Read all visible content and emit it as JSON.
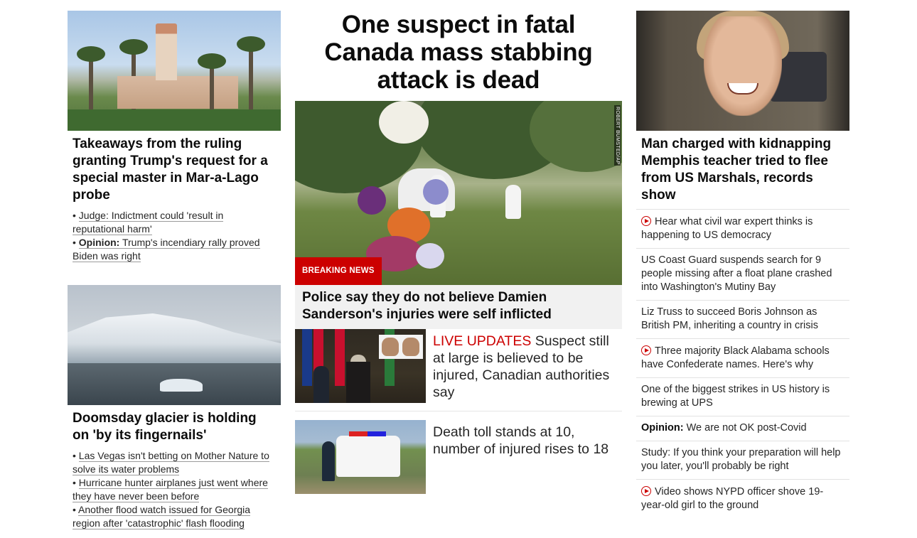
{
  "left": {
    "story1": {
      "image": "mar-a-lago-estate-photo",
      "headline": "Takeaways from the ruling granting Trump's request for a special master in Mar-a-Lago probe",
      "bullets": [
        {
          "label": "",
          "text": "Judge: Indictment could 'result in reputational harm'"
        },
        {
          "label": "Opinion:",
          "text": "Trump's incendiary rally proved Biden was right"
        }
      ]
    },
    "story2": {
      "image": "thwaites-glacier-photo",
      "headline": "Doomsday glacier is holding on 'by its fingernails'",
      "bullets": [
        {
          "label": "",
          "text": "Las Vegas isn't betting on Mother Nature to solve its water problems"
        },
        {
          "label": "",
          "text": "Hurricane hunter airplanes just went where they have never been before"
        },
        {
          "label": "",
          "text": "Another flood watch issued for Georgia region after 'catastrophic' flash flooding"
        }
      ]
    }
  },
  "center": {
    "hero_title": "One suspect in fatal Canada mass stabbing attack is dead",
    "hero_image_credit": "ROBERT BUMSTED/AP",
    "breaking_label": "BREAKING NEWS",
    "hero_sub": "Police say they do not believe Damien Sanderson's injuries were self inflicted",
    "stories": [
      {
        "live": "LIVE UPDATES",
        "text": " Suspect still at large is believed to be injured, Canadian authorities say"
      },
      {
        "live": "",
        "text": "Death toll stands at 10, number of injured rises to 18"
      }
    ]
  },
  "right": {
    "image": "kidnapping-victim-portrait",
    "headline": "Man charged with kidnapping Memphis teacher tried to flee from US Marshals, records show",
    "items": [
      {
        "video": true,
        "label": "",
        "text": "Hear what civil war expert thinks is happening to US democracy"
      },
      {
        "video": false,
        "label": "",
        "text": "US Coast Guard suspends search for 9 people missing after a float plane crashed into Washington's Mutiny Bay"
      },
      {
        "video": false,
        "label": "",
        "text": "Liz Truss to succeed Boris Johnson as British PM, inheriting a country in crisis"
      },
      {
        "video": true,
        "label": "",
        "text": "Three majority Black Alabama schools have Confederate names. Here's why"
      },
      {
        "video": false,
        "label": "",
        "text": "One of the biggest strikes in US history is brewing at UPS"
      },
      {
        "video": false,
        "label": "Opinion:",
        "text": " We are not OK post-Covid"
      },
      {
        "video": false,
        "label": "",
        "text": "Study: If you think your preparation will help you later, you'll probably be right"
      },
      {
        "video": true,
        "label": "",
        "text": "Video shows NYPD officer shove 19-year-old girl to the ground"
      }
    ]
  },
  "colors": {
    "accent_red": "#cc0000",
    "text": "#0c0c0c",
    "subtext": "#262626"
  }
}
